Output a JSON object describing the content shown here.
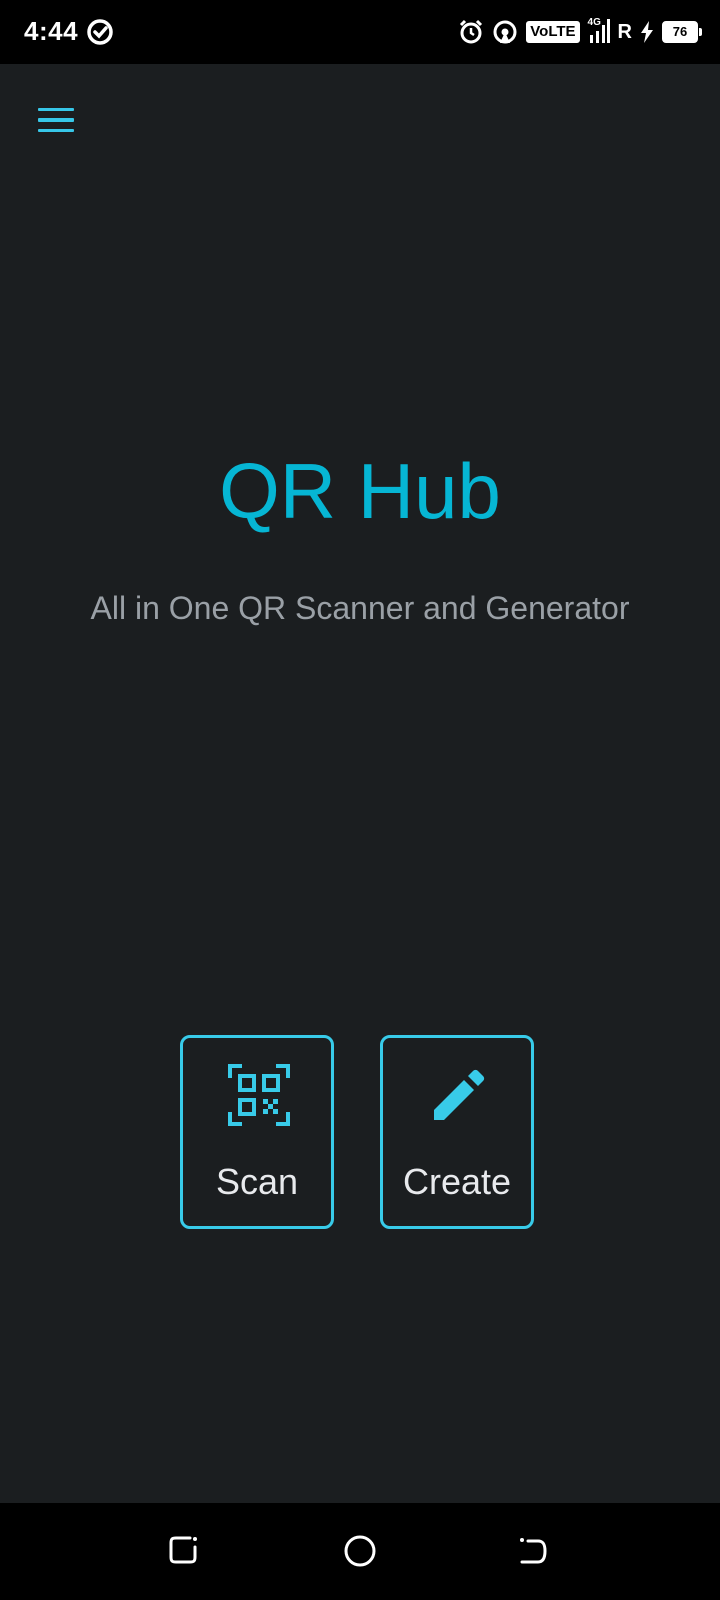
{
  "status_bar": {
    "time": "4:44",
    "network_label": "VoLTE",
    "network_type": "4G",
    "roaming": "R",
    "battery": "76"
  },
  "app": {
    "title": "QR Hub",
    "subtitle": "All in One QR Scanner and Generator"
  },
  "actions": {
    "scan_label": "Scan",
    "create_label": "Create"
  },
  "icons": {
    "menu": "hamburger-menu-icon",
    "scan": "qr-code-scan-icon",
    "create": "pencil-icon",
    "status_left": "data-saver-icon",
    "alarm": "alarm-icon",
    "hotspot": "hotspot-icon",
    "signal": "signal-bars-icon",
    "charging": "charging-bolt-icon",
    "nav_recents": "recents-icon",
    "nav_home": "home-circle-icon",
    "nav_back": "back-icon"
  },
  "colors": {
    "accent": "#38cbe9",
    "title": "#06b6d4",
    "background": "#1b1e20",
    "subtitle": "#9aa0a6"
  }
}
